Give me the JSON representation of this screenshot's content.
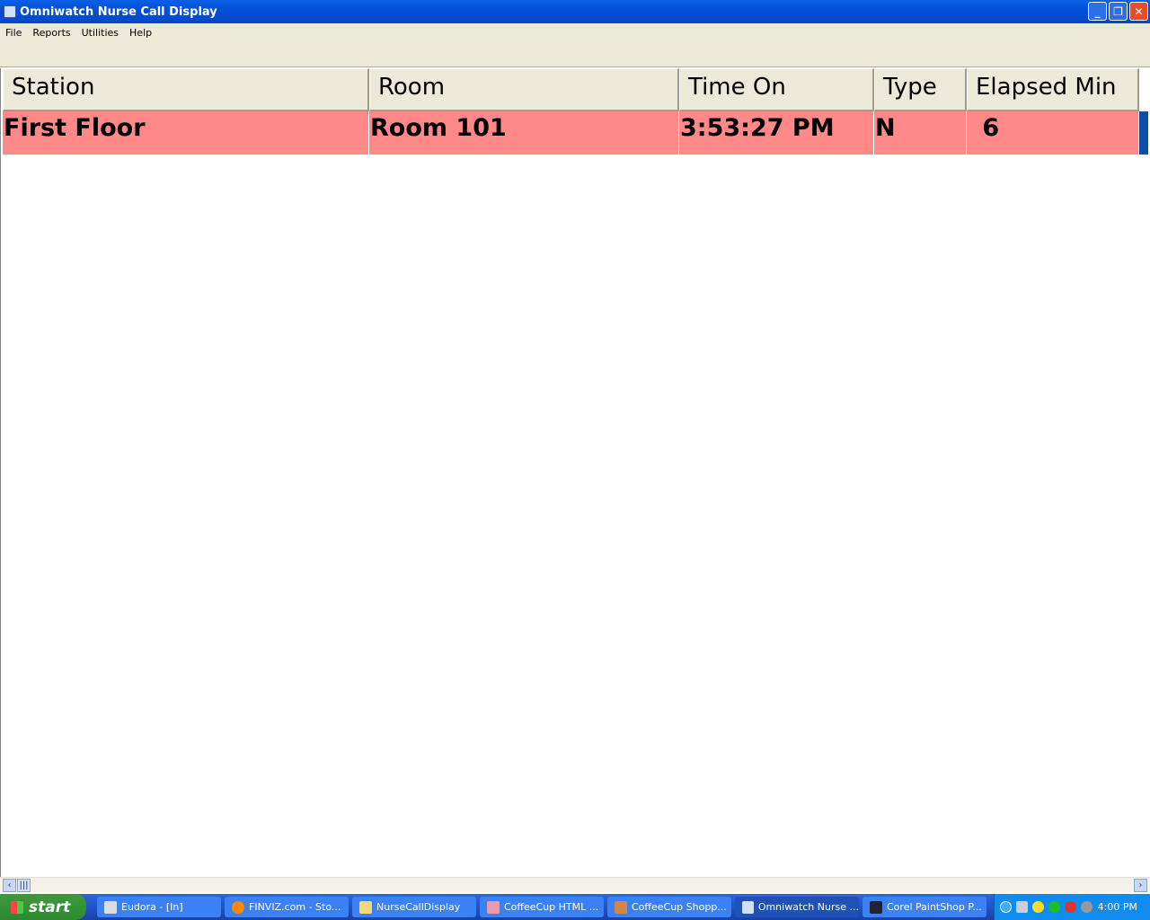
{
  "window": {
    "title": "Omniwatch Nurse Call Display"
  },
  "menu": [
    "File",
    "Reports",
    "Utilities",
    "Help"
  ],
  "table": {
    "columns": [
      "Station",
      "Room",
      "Time On",
      "Type",
      "Elapsed Min"
    ],
    "rows": [
      {
        "station": "First Floor",
        "room": "Room 101",
        "time_on": "3:53:27 PM",
        "type": "N",
        "elapsed": " 6"
      }
    ],
    "row_color": "#ff8888"
  },
  "taskbar": {
    "start": "start",
    "tasks": [
      "Eudora - [In]",
      "FINVIZ.com - Sto...",
      "NurseCallDisplay",
      "CoffeeCup HTML ...",
      "CoffeeCup Shopp...",
      "Omniwatch Nurse ...",
      "Corel PaintShop P..."
    ],
    "active": "Omniwatch Nurse ...",
    "clock": "4:00 PM"
  }
}
